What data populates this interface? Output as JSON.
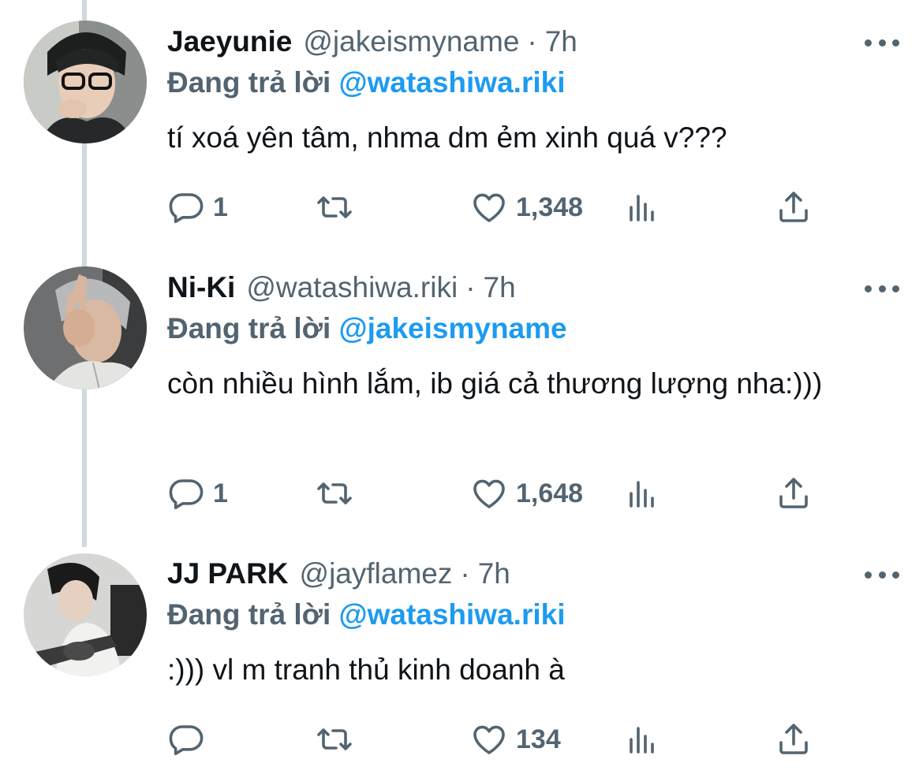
{
  "colors": {
    "accent": "#1d9bf0",
    "secondary_text": "#536471",
    "primary_text": "#0f1419",
    "thread_line": "#cfd9de"
  },
  "icons": {
    "reply": "reply-icon",
    "retweet": "retweet-icon",
    "like": "heart-icon",
    "views": "views-icon",
    "share": "share-icon",
    "more": "more-icon"
  },
  "tweets": [
    {
      "name": "Jaeyunie",
      "handle": "@jakeismyname",
      "separator": "·",
      "time": "7h",
      "reply_prefix": "Đang trả lời",
      "reply_to": "@watashiwa.riki",
      "text": "tí xoá yên tâm, nhma dm ẻm xinh quá v???",
      "replies": "1",
      "likes": "1,348"
    },
    {
      "name": "Ni-Ki",
      "handle": "@watashiwa.riki",
      "separator": "·",
      "time": "7h",
      "reply_prefix": "Đang trả lời",
      "reply_to": "@jakeismyname",
      "text": "còn nhiều hình lắm, ib giá cả thương lượng nha:)))",
      "replies": "1",
      "likes": "1,648"
    },
    {
      "name": "JJ PARK",
      "handle": "@jayflamez",
      "separator": "·",
      "time": "7h",
      "reply_prefix": "Đang trả lời",
      "reply_to": "@watashiwa.riki",
      "text": ":))) vl m tranh thủ kinh doanh à",
      "replies": "",
      "likes": "134"
    }
  ]
}
